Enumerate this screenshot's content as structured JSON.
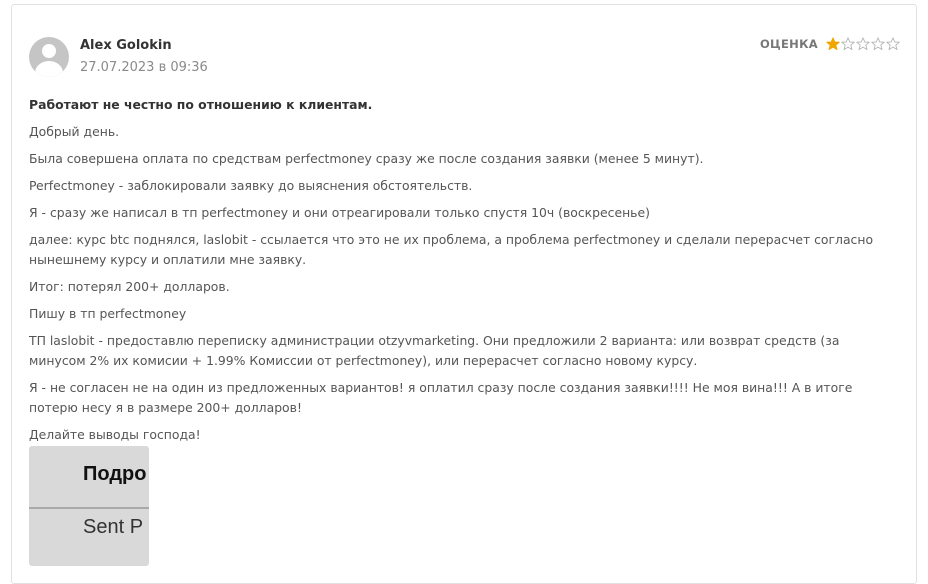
{
  "review": {
    "author": "Alex Golokin",
    "date": "27.07.2023 в 09:36",
    "rating_label": "ОЦЕНКА",
    "rating": 1,
    "rating_max": 5,
    "star_color": "#f0a500",
    "title": "Работают не честно по отношению к клиентам.",
    "paragraphs": [
      "Добрый день.",
      "Была совершена оплата по средствам perfectmoney сразу же после создания заявки (менее 5 минут).",
      "Perfectmoney - заблокировали заявку до выяснения обстоятельств.",
      "Я - сразу же написал в тп perfectmoney и они отреагировали только спустя 10ч (воскресенье)",
      "далее: курс btc поднялся, laslobit - ссылается что это не их проблема, а проблема perfectmoney и сделали перерасчет согласно нынешнему курсу и оплатили мне заявку.",
      "Итог: потерял 200+ долларов.",
      "Пишу в тп perfectmoney",
      "ТП laslobit - предоставлю переписку администрации otzyvmarketing. Они предложили 2 варианта: или возврат средств (за минусом 2% их комисии + 1.99% Комиссии от perfectmoney), или перерасчет согласно новому курсу.",
      "Я - не согласен не на один из предложенных вариантов! я оплатил сразу после создания заявки!!!! Не моя вина!!! А в итоге потерю несу я в размере 200+ долларов!",
      "Делайте выводы господа!"
    ],
    "attachment": {
      "line1": "Подро",
      "line2": "Sent P"
    }
  }
}
